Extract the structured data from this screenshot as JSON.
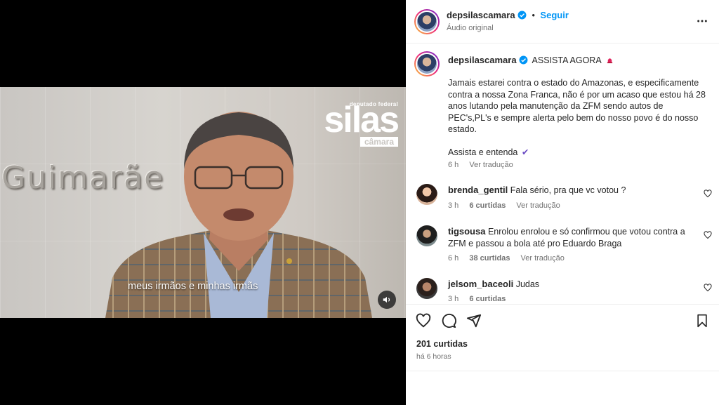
{
  "video": {
    "wall_text": "Guimarãe",
    "brand_top": "deputado federal",
    "brand_main": "silas",
    "brand_bottom": "câmara",
    "subtitle": "meus irmãos e minhas irmãs"
  },
  "header": {
    "username": "depsilascamara",
    "separator": "•",
    "follow_label": "Seguir",
    "audio_label": "Áudio original"
  },
  "caption": {
    "username": "depsilascamara",
    "headline": "ASSISTA AGORA",
    "body_lines": [
      "Jamais estarei contra o estado do Amazonas, e especificamente",
      "contra a nossa Zona Franca, não é por um acaso que estou há 28",
      "anos lutando pela manutenção da ZFM sendo autos de",
      "PEC's,PL's e sempre alerta pelo bem do nosso povo é do nosso",
      "estado."
    ],
    "closing": "Assista e entenda",
    "closing_emoji": "✔",
    "time": "6 h",
    "translate": "Ver tradução"
  },
  "comments": [
    {
      "username": "brenda_gentil",
      "text_lines": [
        "Fala sério, pra que vc votou ?"
      ],
      "time": "3 h",
      "likes": "6 curtidas",
      "translate": "Ver tradução"
    },
    {
      "username": "tigsousa",
      "text_lines": [
        "Enrolou enrolou e só confirmou que votou contra a",
        "ZFM e passou a bola até pro Eduardo Braga"
      ],
      "time": "6 h",
      "likes": "38 curtidas",
      "translate": "Ver tradução"
    },
    {
      "username": "jelsom_baceoli",
      "text_lines": [
        "Judas"
      ],
      "time": "3 h",
      "likes": "6 curtidas",
      "translate": ""
    }
  ],
  "footer": {
    "likes": "201 curtidas",
    "posted": "há 6 horas"
  },
  "colors": {
    "link_blue": "#0095f6",
    "verified_blue": "#0095f6",
    "text_primary": "#262626",
    "text_secondary": "#737373"
  }
}
